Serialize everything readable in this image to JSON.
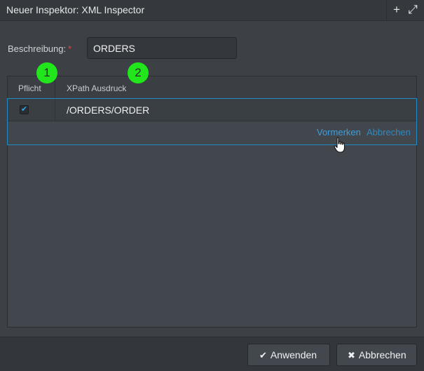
{
  "window": {
    "title": "Neuer Inspektor: XML Inspector",
    "plus_icon": "+",
    "maximize_icon": "⤢"
  },
  "form": {
    "description_label": "Beschreibung:",
    "required_marker": "*",
    "description_value": "ORDERS"
  },
  "grid": {
    "columns": [
      "Pflicht",
      "XPath Ausdruck"
    ],
    "rows": [
      {
        "required": true,
        "check_glyph": "✔",
        "xpath": "/ORDERS/ORDER"
      }
    ],
    "row_actions": {
      "save": "Vormerken",
      "cancel": "Abbrechen"
    }
  },
  "badges": [
    "1",
    "2"
  ],
  "footer": {
    "apply_icon": "✔",
    "apply_label": "Anwenden",
    "cancel_icon": "✖",
    "cancel_label": "Abbrechen"
  }
}
